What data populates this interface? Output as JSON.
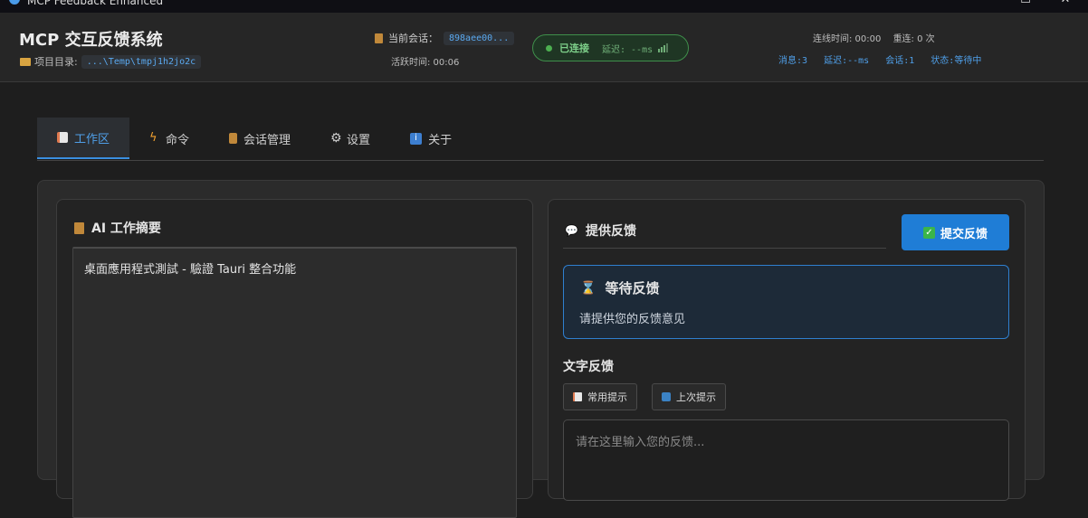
{
  "window": {
    "title": "MCP Feedback Enhanced"
  },
  "header": {
    "app_title": "MCP 交互反馈系统",
    "project_label": "项目目录:",
    "project_path": "...\\Temp\\tmpj1h2jo2c",
    "session_label": "当前会话：",
    "session_id": "898aee00...",
    "active_time": "活跃时间: 00:06",
    "status": "已连接",
    "latency": "延迟: --ms",
    "online_time": "连线时间: 00:00",
    "reconnect": "重连: 0 次",
    "stats": [
      "消息:3",
      "延迟:--ms",
      "会话:1",
      "状态:等待中"
    ]
  },
  "tabs": [
    {
      "label": "工作区",
      "icon": "document-icon",
      "active": true
    },
    {
      "label": "命令",
      "icon": "lightning-icon",
      "active": false
    },
    {
      "label": "会话管理",
      "icon": "clipboard-icon",
      "active": false
    },
    {
      "label": "设置",
      "icon": "gear-icon",
      "active": false
    },
    {
      "label": "关于",
      "icon": "info-icon",
      "active": false
    }
  ],
  "summary": {
    "title": "AI 工作摘要",
    "content": "桌面應用程式測試 - 驗證 Tauri 整合功能"
  },
  "feedback": {
    "title": "提供反馈",
    "submit_label": "提交反馈",
    "wait_title": "等待反馈",
    "wait_desc": "请提供您的反馈意见",
    "text_label": "文字反馈",
    "common_prompts": "常用提示",
    "last_prompt": "上次提示",
    "placeholder": "请在这里输入您的反馈..."
  },
  "colors": {
    "accent": "#1f7dd6",
    "connected": "#4caf50",
    "background": "#1e1e1e"
  }
}
